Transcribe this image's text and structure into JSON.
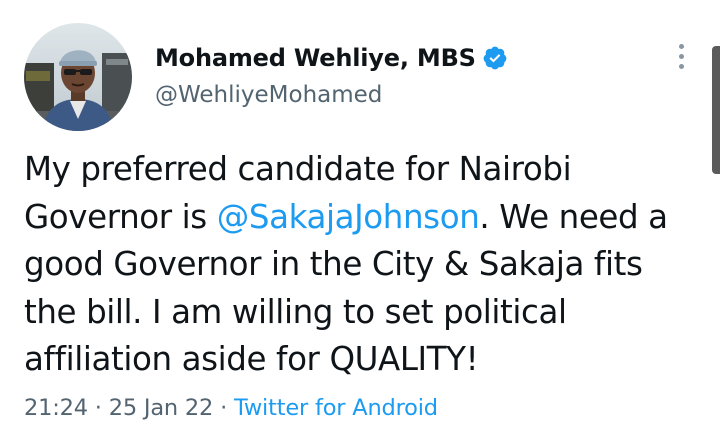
{
  "author": {
    "display_name": "Mohamed Wehliye, MBS",
    "handle": "@WehliyeMohamed",
    "verified_icon": "verified-badge-icon",
    "avatar_icon": "profile-photo"
  },
  "tweet": {
    "text_before": "My preferred candidate for Nairobi\nGovernor is ",
    "mention": "@SakajaJohnson",
    "text_after": ". We need a\ngood Governor in the City & Sakaja fits\nthe bill. I am willing to set political\naffiliation aside for QUALITY!"
  },
  "meta": {
    "time": "21:24",
    "separator": " · ",
    "date": "25 Jan 22",
    "source": "Twitter for Android"
  },
  "colors": {
    "accent": "#1d9bf0",
    "secondary_text": "#536471",
    "primary_text": "#0f1419"
  },
  "more_icon": "more-vertical-icon"
}
